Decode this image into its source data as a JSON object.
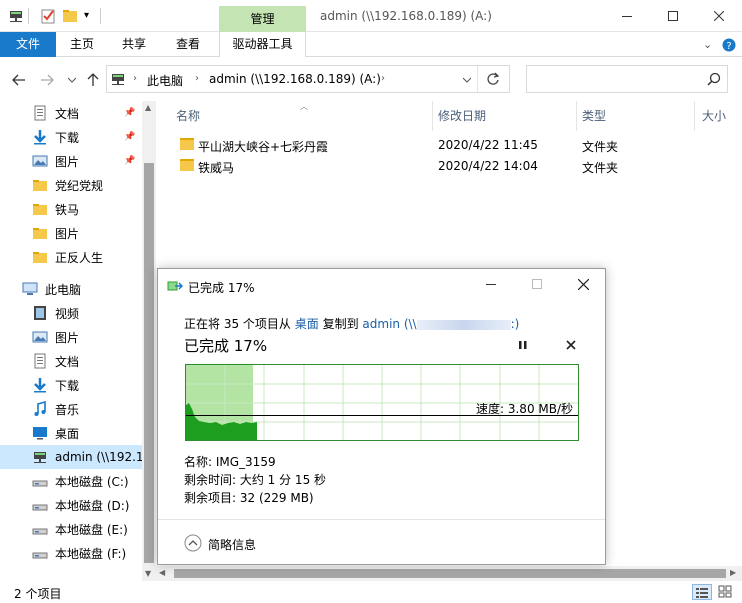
{
  "window": {
    "title": "admin (\\\\192.168.0.189) (A:)",
    "manage_tab": "管理"
  },
  "ribbon": {
    "tabs": [
      "文件",
      "主页",
      "共享",
      "查看",
      "驱动器工具"
    ]
  },
  "address": {
    "crumbs": [
      "此电脑",
      "admin (\\\\192.168.0.189) (A:)"
    ],
    "search_placeholder": ""
  },
  "sidebar": {
    "items": [
      {
        "label": "文档",
        "icon": "document-icon",
        "pinned": true
      },
      {
        "label": "下载",
        "icon": "download-icon",
        "pinned": true
      },
      {
        "label": "图片",
        "icon": "pictures-icon",
        "pinned": true
      },
      {
        "label": "党纪党规",
        "icon": "folder-icon",
        "pinned": false
      },
      {
        "label": "铁马",
        "icon": "folder-icon",
        "pinned": false
      },
      {
        "label": "图片",
        "icon": "folder-icon",
        "pinned": false
      },
      {
        "label": "正反人生",
        "icon": "folder-icon",
        "pinned": false
      },
      {
        "label": "此电脑",
        "icon": "computer-icon",
        "pinned": false
      },
      {
        "label": "视频",
        "icon": "video-icon",
        "pinned": false
      },
      {
        "label": "图片",
        "icon": "pictures-icon",
        "pinned": false
      },
      {
        "label": "文档",
        "icon": "document-icon",
        "pinned": false
      },
      {
        "label": "下载",
        "icon": "download-icon",
        "pinned": false
      },
      {
        "label": "音乐",
        "icon": "music-icon",
        "pinned": false
      },
      {
        "label": "桌面",
        "icon": "desktop-icon",
        "pinned": false
      },
      {
        "label": "admin (\\\\192.1",
        "icon": "network-drive-icon",
        "pinned": false
      },
      {
        "label": "本地磁盘 (C:)",
        "icon": "drive-icon",
        "pinned": false
      },
      {
        "label": "本地磁盘 (D:)",
        "icon": "drive-icon",
        "pinned": false
      },
      {
        "label": "本地磁盘 (E:)",
        "icon": "drive-icon",
        "pinned": false
      },
      {
        "label": "本地磁盘 (F:)",
        "icon": "drive-icon",
        "pinned": false
      }
    ]
  },
  "columns": {
    "name": "名称",
    "modified": "修改日期",
    "type": "类型",
    "size": "大小"
  },
  "files": [
    {
      "name": "平山湖大峡谷+七彩丹霞",
      "modified": "2020/4/22 11:45",
      "type": "文件夹"
    },
    {
      "name": "铁威马",
      "modified": "2020/4/22 14:04",
      "type": "文件夹"
    }
  ],
  "status": {
    "count": "2 个项目"
  },
  "dialog": {
    "title": "已完成 17%",
    "copy_prefix": "正在将 35 个项目从",
    "copy_from": "桌面",
    "copy_middle": "复制到",
    "copy_to": "admin (\\\\",
    "copy_to_suffix": ":)",
    "progress_title": "已完成 17%",
    "progress_percent": 17,
    "speed": "速度: 3.80 MB/秒",
    "name_line": "名称: IMG_3159",
    "time_line": "剩余时间: 大约 1 分 15 秒",
    "items_line": "剩余项目: 32 (229 MB)",
    "details_label": "简略信息"
  },
  "colors": {
    "accent": "#1979ca",
    "manage_tab": "#c5e4b4",
    "progress_fill": "#b4e4a4",
    "progress_graph": "#2ca02c",
    "selected": "#cce8ff"
  }
}
